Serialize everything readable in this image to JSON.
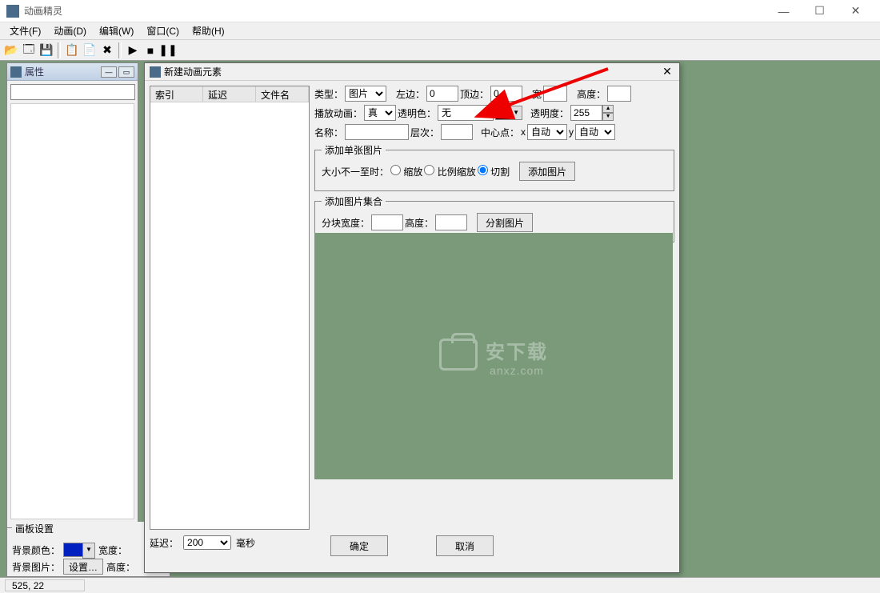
{
  "app": {
    "title": "动画精灵"
  },
  "menu": {
    "file": "文件(F)",
    "anim": "动画(D)",
    "edit": "编辑(W)",
    "window": "窗口(C)",
    "help": "帮助(H)"
  },
  "toolbar_icons": {
    "open": "📂",
    "new": "🗔",
    "save": "💾",
    "copy": "📋",
    "paste": "📄",
    "delete": "✖",
    "play": "▶",
    "stop": "■",
    "pause": "❚❚"
  },
  "proppanel": {
    "title": "属性"
  },
  "canvasgrp": {
    "legend": "画板设置",
    "bgcolor_label": "背景颜色：",
    "width_label": "宽度：",
    "bgimg_label": "背景图片：",
    "setbtn": "设置…",
    "height_label": "高度："
  },
  "dialog": {
    "title": "新建动画元素",
    "list_headers": {
      "index": "索引",
      "delay": "延迟",
      "filename": "文件名"
    },
    "row1": {
      "type_label": "类型：",
      "type_value": "图片",
      "left_label": "左边：",
      "left_value": "0",
      "top_label": "顶边：",
      "top_value": "0",
      "w_label": "宽",
      "w_value": "",
      "h_label": "高度：",
      "h_value": ""
    },
    "row2": {
      "playanim_label": "播放动画：",
      "playanim_value": "真",
      "transcolor_label": "透明色：",
      "transcolor_value": "无",
      "opacity_label": "透明度：",
      "opacity_value": "255"
    },
    "row3": {
      "name_label": "名称：",
      "name_value": "",
      "layer_label": "层次：",
      "layer_value": "",
      "center_label": "中心点：",
      "x_label": "x",
      "x_value": "自动",
      "y_label": "y",
      "y_value": "自动"
    },
    "grp1": {
      "legend": "添加单张图片",
      "sizelabel": "大小不一至时：",
      "radio_scale": "缩放",
      "radio_propscale": "比例缩放",
      "radio_cut": "切割",
      "addbtn": "添加图片"
    },
    "grp2": {
      "legend": "添加图片集合",
      "blockw_label": "分块宽度：",
      "h_label": "高度：",
      "splitbtn": "分割图片"
    },
    "delay_label": "延迟：",
    "delay_value": "200",
    "delay_unit": "毫秒",
    "ok": "确定",
    "cancel": "取消"
  },
  "watermark": {
    "text1": "安下载",
    "text2": "anxz.com"
  },
  "statusbar": {
    "coords": "525, 22"
  }
}
